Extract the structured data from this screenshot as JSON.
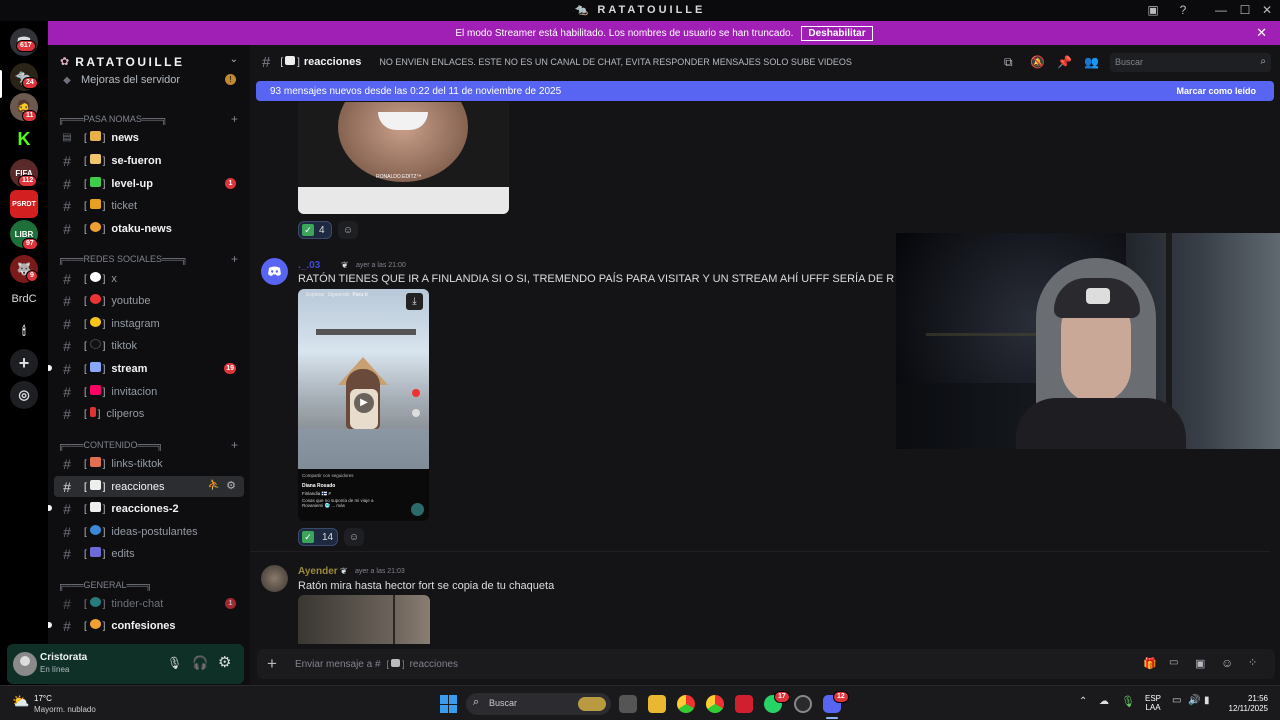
{
  "window": {
    "title": "RATATOUILLE"
  },
  "banner": {
    "text": "El modo Streamer está habilitado. Los nombres de usuario se han truncado.",
    "button": "Deshabilitar"
  },
  "rail": {
    "badges": [
      "617",
      "24",
      "11",
      "112",
      "97",
      "9"
    ],
    "folder_label": "BrdC"
  },
  "server": {
    "name": "RATATOUILLE",
    "boost_item": "Mejoras del servidor"
  },
  "categories": {
    "pasa": "╔═══PASA NOMAS═══╗",
    "redes": "╔═══REDES SOCIALES═══╗",
    "contenido": "╔═══CONTENIDO═══╗",
    "general": "╔═══GENERAL═══╗"
  },
  "channels": [
    {
      "label": "news",
      "bracket": "[",
      "color": "#e8b24a"
    },
    {
      "label": "se-fueron",
      "bracket": "[",
      "color": "#f0c36d"
    },
    {
      "label": "level-up",
      "bracket": "[",
      "color": "#3ecf4a",
      "badge": "1"
    },
    {
      "label": "ticket",
      "bracket": "[",
      "color": "#e8a020"
    },
    {
      "label": "otaku-news",
      "bracket": "[",
      "color": "#f0a030"
    },
    {
      "label": "x",
      "bracket": "[",
      "color": "#ffffff"
    },
    {
      "label": "youtube",
      "bracket": "[",
      "color": "#e33"
    },
    {
      "label": "instagram",
      "bracket": "[",
      "color": "#f5c518"
    },
    {
      "label": "tiktok",
      "bracket": "[",
      "color": "#111"
    },
    {
      "label": "stream",
      "bracket": "[",
      "color": "#8aa8ff",
      "badge": "19"
    },
    {
      "label": "invitacion",
      "bracket": "[",
      "color": "#f06"
    },
    {
      "label": "cliperos",
      "bracket": "[",
      "color": "#d33"
    },
    {
      "label": "links-tiktok",
      "bracket": "[",
      "color": "#e07050"
    },
    {
      "label": "reacciones",
      "bracket": "[",
      "color": "#eee"
    },
    {
      "label": "reacciones-2",
      "bracket": "[",
      "color": "#eee"
    },
    {
      "label": "ideas-postulantes",
      "bracket": "[",
      "color": "#3a8ad8"
    },
    {
      "label": "edits",
      "bracket": "[",
      "color": "#6a6ad8"
    },
    {
      "label": "tinder-chat",
      "bracket": "[",
      "color": "#3aa"
    },
    {
      "label": "confesiones",
      "bracket": "[",
      "color": "#f0a030"
    }
  ],
  "header": {
    "channel": "reacciones",
    "topic": "NO ENVIEN ENLACES. ESTE NO ES UN CANAL DE CHAT, EVITA RESPONDER MENSAJES SOLO SUBE VIDEOS",
    "search_placeholder": "Buscar"
  },
  "new_messages": {
    "text": "93 mensajes nuevos desde las 0:22 del 11 de noviembre de 2025",
    "mark_read": "Marcar como leído"
  },
  "messages": [
    {
      "author": "._.03",
      "time": "ayer a las 21:00",
      "text": "RATÓN TIENES QUE IR A FINLANDIA SI O SI, TREMENDO PAÍS PARA VISITAR Y UN STREAM AHÍ UFFF SERÍA DE R Y R XD",
      "reaction_count": "14"
    },
    {
      "author": "Ayender",
      "time": "ayer a las 21:03",
      "text": "Ratón mira hasta hector fort se copia de tu chaqueta"
    }
  ],
  "prev_reaction_count": "4",
  "image_caption": "RONALDO.EDITZ™",
  "video_overlay": {
    "tabs": [
      "Explorar",
      "Siguiendo",
      "Para ti"
    ],
    "shared": "Compartir con seguidores",
    "author": "Diana Rosado",
    "place": "Finlandia 🇫🇮 #",
    "desc": "Cosas que no suponía de mi viaje a Rovaniemi 🥶 ... más"
  },
  "composer": {
    "placeholder_prefix": "Enviar mensaje a #",
    "channel": "reacciones"
  },
  "user": {
    "name": "Cristorata",
    "status": "En línea"
  },
  "taskbar": {
    "weather_temp": "17°C",
    "weather_desc": "Mayorm. nublado",
    "search": "Buscar",
    "lang1": "ESP",
    "lang2": "LAA",
    "time": "21:56",
    "date": "12/11/2025",
    "whatsapp_badge": "17",
    "discord_badge": "12"
  }
}
